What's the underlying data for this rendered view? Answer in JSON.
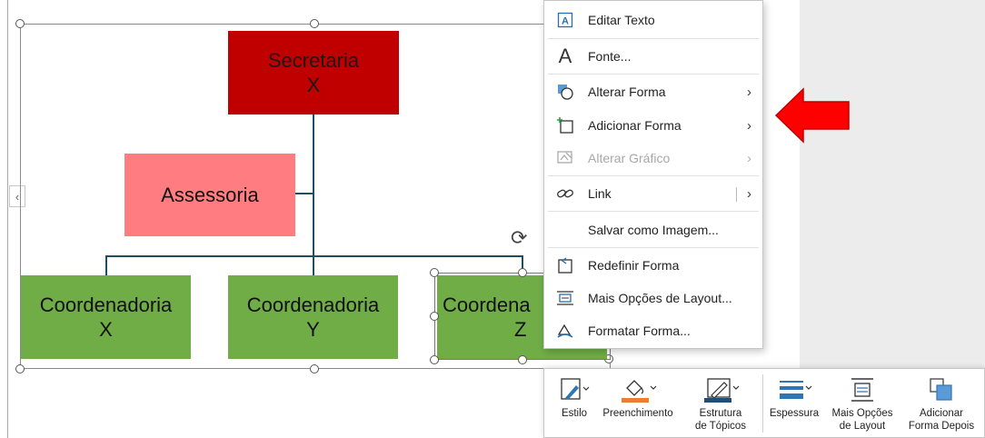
{
  "org_chart": {
    "top": {
      "line1": "Secretaria",
      "line2": "X"
    },
    "assistant": {
      "label": "Assessoria"
    },
    "coords": [
      {
        "line1": "Coordenadoria",
        "line2": "X"
      },
      {
        "line1": "Coordenadoria",
        "line2": "Y"
      },
      {
        "line1": "Coordena",
        "line2": "Z"
      }
    ]
  },
  "context_menu": {
    "items": [
      {
        "label": "Editar Texto",
        "icon": "text-box-icon"
      },
      {
        "label": "Fonte...",
        "icon": "font-icon"
      },
      {
        "label": "Alterar Forma",
        "icon": "change-shape-icon",
        "submenu": true
      },
      {
        "label": "Adicionar Forma",
        "icon": "add-shape-icon",
        "submenu": true
      },
      {
        "label": "Alterar Gráfico",
        "icon": "change-graphic-icon",
        "submenu": true,
        "disabled": true
      },
      {
        "label": "Link",
        "icon": "link-icon",
        "submenu": true
      },
      {
        "label": "Salvar como Imagem..."
      },
      {
        "label": "Redefinir Forma",
        "icon": "reset-shape-icon"
      },
      {
        "label": "Mais Opções de Layout...",
        "icon": "layout-options-icon"
      },
      {
        "label": "Formatar Forma...",
        "icon": "format-shape-icon"
      }
    ]
  },
  "mini_toolbar": {
    "estilo": "Estilo",
    "preenchimento": "Preenchimento",
    "estrutura": "Estrutura\nde Tópicos",
    "espessura": "Espessura",
    "mais_opcoes": "Mais Opções\nde Layout",
    "adicionar": "Adicionar\nForma Depois"
  },
  "colors": {
    "top_box": "#c00000",
    "assistant_box": "#ff7c80",
    "coord_box": "#70ad47",
    "connector": "#1f4e5f",
    "arrow": "#ff0000",
    "fill_swatch": "#ed7d31",
    "outline_swatch": "#1f4e79",
    "weight_icon": "#2e75b6"
  }
}
